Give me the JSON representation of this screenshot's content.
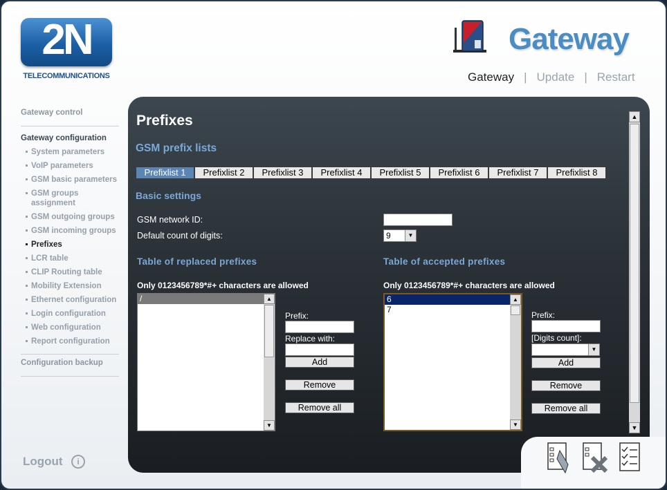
{
  "brand": {
    "logo_text": "2N",
    "logo_sub": "TELECOMMUNICATIONS",
    "product": "Gateway"
  },
  "topnav": [
    {
      "label": "Gateway"
    },
    {
      "label": "Update"
    },
    {
      "label": "Restart"
    }
  ],
  "topnav_sep": "|",
  "sidebar": {
    "gateway_control": "Gateway control",
    "gateway_configuration": "Gateway configuration",
    "items": [
      {
        "label": "System parameters"
      },
      {
        "label": "VoIP parameters"
      },
      {
        "label": "GSM basic parameters"
      },
      {
        "label": "GSM groups assignment"
      },
      {
        "label": "GSM outgoing groups"
      },
      {
        "label": "GSM incoming groups"
      },
      {
        "label": "Prefixes"
      },
      {
        "label": "LCR table"
      },
      {
        "label": "CLIP Routing table"
      },
      {
        "label": "Mobility Extension"
      },
      {
        "label": "Ethernet configuration"
      },
      {
        "label": "Login configuration"
      },
      {
        "label": "Web configuration"
      },
      {
        "label": "Report configuration"
      }
    ],
    "configuration_backup": "Configuration backup",
    "logout": "Logout"
  },
  "main": {
    "title": "Prefixes",
    "section_lists": "GSM prefix lists",
    "tabs": [
      "Prefixlist 1",
      "Prefixlist 2",
      "Prefixlist 3",
      "Prefixlist 4",
      "Prefixlist 5",
      "Prefixlist 6",
      "Prefixlist 7",
      "Prefixlist 8"
    ],
    "active_tab": "Prefixlist 1",
    "basic_settings": "Basic settings",
    "gsm_network_id_label": "GSM network ID:",
    "gsm_network_id_value": "",
    "default_digits_label": "Default count of digits:",
    "default_digits_value": "9",
    "replaced": {
      "title": "Table of replaced prefixes",
      "note": "Only 0123456789*#+ characters are allowed",
      "items": [
        "/"
      ],
      "prefix_label": "Prefix:",
      "prefix_value": "",
      "replace_label": "Replace with:",
      "replace_value": "",
      "add": "Add",
      "remove": "Remove",
      "remove_all": "Remove all"
    },
    "accepted": {
      "title": "Table of accepted prefixes",
      "note": "Only 0123456789*#+ characters are allowed",
      "items": [
        "6",
        "7"
      ],
      "prefix_label": "Prefix:",
      "prefix_value": "",
      "digits_label": "[Digits count]:",
      "digits_value": "",
      "add": "Add",
      "remove": "Remove",
      "remove_all": "Remove all"
    }
  },
  "footer_icons": [
    "save-config-icon",
    "cancel-config-icon",
    "checklist-icon"
  ],
  "colors": {
    "accent": "#4a8cc4",
    "panel": "#2b3238",
    "active_tab": "#5b86b4",
    "list_select": "#0a246a"
  }
}
